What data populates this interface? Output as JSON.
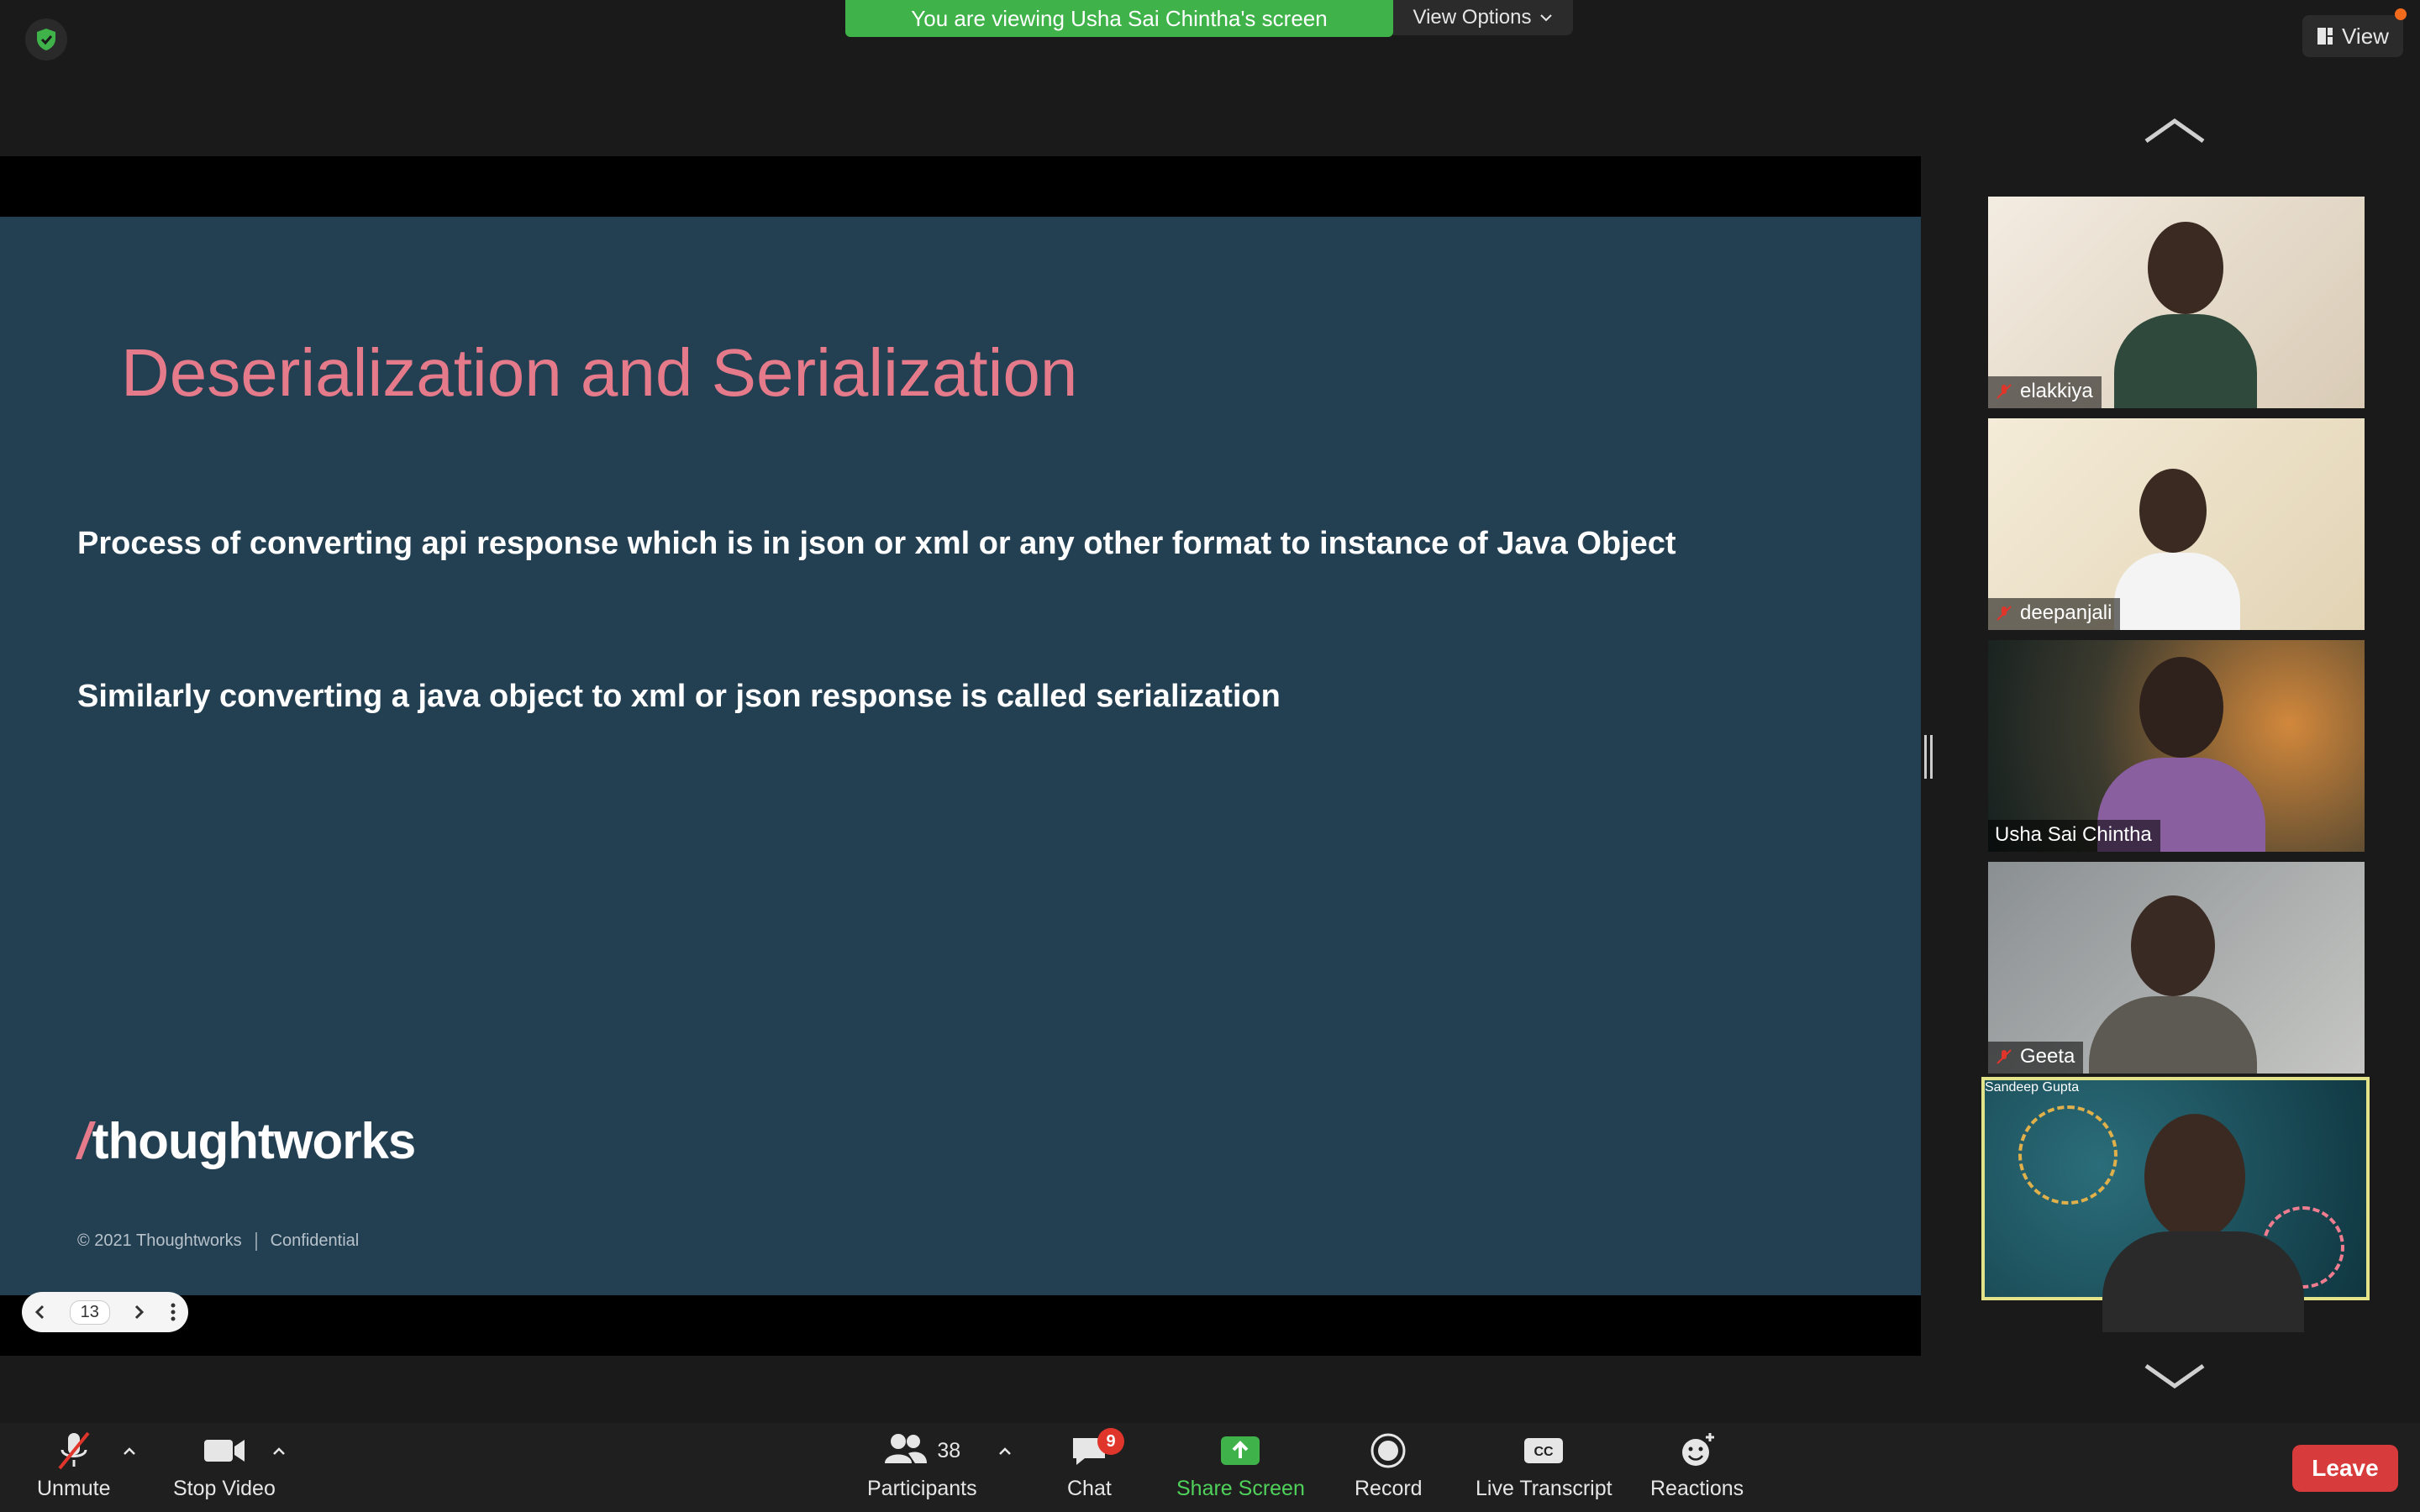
{
  "meeting": {
    "banner_text": "You are viewing Usha Sai Chintha's screen",
    "view_options_label": "View Options",
    "view_label": "View"
  },
  "slide": {
    "title": "Deserialization and Serialization",
    "line1": "Process of converting api response which is in json or xml or any other format to instance of Java Object",
    "line2": "Similarly converting a java object to xml or json response is called serialization",
    "logo_text": "thoughtworks",
    "copyright": "© 2021 Thoughtworks",
    "confidential": "Confidential",
    "page_number": "13"
  },
  "participants": [
    {
      "name": "elakkiya",
      "muted": true
    },
    {
      "name": "deepanjali",
      "muted": true
    },
    {
      "name": "Usha Sai Chintha",
      "muted": false
    },
    {
      "name": "Geeta",
      "muted": true
    },
    {
      "name": "Sandeep Gupta",
      "muted": false,
      "active_speaker": true
    }
  ],
  "toolbar": {
    "unmute_label": "Unmute",
    "stop_video_label": "Stop Video",
    "participants_label": "Participants",
    "participants_count": "38",
    "chat_label": "Chat",
    "chat_badge": "9",
    "share_screen_label": "Share Screen",
    "record_label": "Record",
    "live_transcript_label": "Live Transcript",
    "reactions_label": "Reactions",
    "leave_label": "Leave"
  },
  "colors": {
    "banner_green": "#3fb24a",
    "slide_background": "#233f52",
    "slide_title": "#e57a8a",
    "leave_red": "#d83b3b",
    "active_speaker_border": "#e3e38a"
  }
}
